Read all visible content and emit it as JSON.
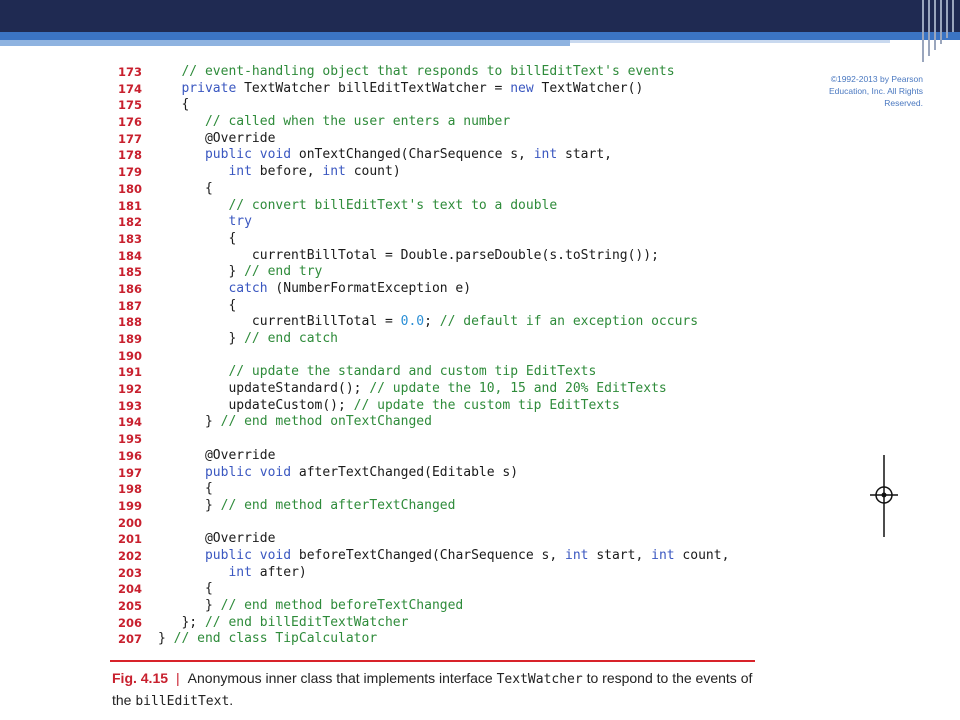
{
  "copyright": {
    "line1": "©1992-2013 by Pearson",
    "line2": "Education, Inc. All Rights",
    "line3": "Reserved."
  },
  "code": {
    "lines": [
      {
        "num": "173",
        "segments": [
          {
            "t": "   ",
            "k": "code"
          },
          {
            "t": "// event-handling object that responds to billEditText's events",
            "k": "comment"
          }
        ]
      },
      {
        "num": "174",
        "segments": [
          {
            "t": "   ",
            "k": "code"
          },
          {
            "t": "private",
            "k": "keyword"
          },
          {
            "t": " TextWatcher billEditTextWatcher = ",
            "k": "code"
          },
          {
            "t": "new",
            "k": "keyword"
          },
          {
            "t": " TextWatcher()",
            "k": "code"
          }
        ]
      },
      {
        "num": "175",
        "segments": [
          {
            "t": "   {",
            "k": "code"
          }
        ]
      },
      {
        "num": "176",
        "segments": [
          {
            "t": "      ",
            "k": "code"
          },
          {
            "t": "// called when the user enters a number",
            "k": "comment"
          }
        ]
      },
      {
        "num": "177",
        "segments": [
          {
            "t": "      @Override",
            "k": "code"
          }
        ]
      },
      {
        "num": "178",
        "segments": [
          {
            "t": "      ",
            "k": "code"
          },
          {
            "t": "public",
            "k": "keyword"
          },
          {
            "t": " ",
            "k": "code"
          },
          {
            "t": "void",
            "k": "keyword"
          },
          {
            "t": " onTextChanged(CharSequence s, ",
            "k": "code"
          },
          {
            "t": "int",
            "k": "keyword"
          },
          {
            "t": " start,",
            "k": "code"
          }
        ]
      },
      {
        "num": "179",
        "segments": [
          {
            "t": "         ",
            "k": "code"
          },
          {
            "t": "int",
            "k": "keyword"
          },
          {
            "t": " before, ",
            "k": "code"
          },
          {
            "t": "int",
            "k": "keyword"
          },
          {
            "t": " count)",
            "k": "code"
          }
        ]
      },
      {
        "num": "180",
        "segments": [
          {
            "t": "      {",
            "k": "code"
          }
        ]
      },
      {
        "num": "181",
        "segments": [
          {
            "t": "         ",
            "k": "code"
          },
          {
            "t": "// convert billEditText's text to a double",
            "k": "comment"
          }
        ]
      },
      {
        "num": "182",
        "segments": [
          {
            "t": "         ",
            "k": "code"
          },
          {
            "t": "try",
            "k": "keyword"
          }
        ]
      },
      {
        "num": "183",
        "segments": [
          {
            "t": "         {",
            "k": "code"
          }
        ]
      },
      {
        "num": "184",
        "segments": [
          {
            "t": "            currentBillTotal = Double.parseDouble(s.toString());",
            "k": "code"
          }
        ]
      },
      {
        "num": "185",
        "segments": [
          {
            "t": "         } ",
            "k": "code"
          },
          {
            "t": "// end try",
            "k": "comment"
          }
        ]
      },
      {
        "num": "186",
        "segments": [
          {
            "t": "         ",
            "k": "code"
          },
          {
            "t": "catch",
            "k": "keyword"
          },
          {
            "t": " (NumberFormatException e)",
            "k": "code"
          }
        ]
      },
      {
        "num": "187",
        "segments": [
          {
            "t": "         {",
            "k": "code"
          }
        ]
      },
      {
        "num": "188",
        "segments": [
          {
            "t": "            currentBillTotal = ",
            "k": "code"
          },
          {
            "t": "0.0",
            "k": "number"
          },
          {
            "t": "; ",
            "k": "code"
          },
          {
            "t": "// default if an exception occurs",
            "k": "comment"
          }
        ]
      },
      {
        "num": "189",
        "segments": [
          {
            "t": "         } ",
            "k": "code"
          },
          {
            "t": "// end catch",
            "k": "comment"
          }
        ]
      },
      {
        "num": "190",
        "segments": []
      },
      {
        "num": "191",
        "segments": [
          {
            "t": "         ",
            "k": "code"
          },
          {
            "t": "// update the standard and custom tip EditTexts",
            "k": "comment"
          }
        ]
      },
      {
        "num": "192",
        "segments": [
          {
            "t": "         updateStandard(); ",
            "k": "code"
          },
          {
            "t": "// update the 10, 15 and 20% EditTexts",
            "k": "comment"
          }
        ]
      },
      {
        "num": "193",
        "segments": [
          {
            "t": "         updateCustom(); ",
            "k": "code"
          },
          {
            "t": "// update the custom tip EditTexts",
            "k": "comment"
          }
        ]
      },
      {
        "num": "194",
        "segments": [
          {
            "t": "      } ",
            "k": "code"
          },
          {
            "t": "// end method onTextChanged",
            "k": "comment"
          }
        ]
      },
      {
        "num": "195",
        "segments": []
      },
      {
        "num": "196",
        "segments": [
          {
            "t": "      @Override",
            "k": "code"
          }
        ]
      },
      {
        "num": "197",
        "segments": [
          {
            "t": "      ",
            "k": "code"
          },
          {
            "t": "public",
            "k": "keyword"
          },
          {
            "t": " ",
            "k": "code"
          },
          {
            "t": "void",
            "k": "keyword"
          },
          {
            "t": " afterTextChanged(Editable s)",
            "k": "code"
          }
        ]
      },
      {
        "num": "198",
        "segments": [
          {
            "t": "      {",
            "k": "code"
          }
        ]
      },
      {
        "num": "199",
        "segments": [
          {
            "t": "      } ",
            "k": "code"
          },
          {
            "t": "// end method afterTextChanged",
            "k": "comment"
          }
        ]
      },
      {
        "num": "200",
        "segments": []
      },
      {
        "num": "201",
        "segments": [
          {
            "t": "      @Override",
            "k": "code"
          }
        ]
      },
      {
        "num": "202",
        "segments": [
          {
            "t": "      ",
            "k": "code"
          },
          {
            "t": "public",
            "k": "keyword"
          },
          {
            "t": " ",
            "k": "code"
          },
          {
            "t": "void",
            "k": "keyword"
          },
          {
            "t": " beforeTextChanged(CharSequence s, ",
            "k": "code"
          },
          {
            "t": "int",
            "k": "keyword"
          },
          {
            "t": " start, ",
            "k": "code"
          },
          {
            "t": "int",
            "k": "keyword"
          },
          {
            "t": " count,",
            "k": "code"
          }
        ]
      },
      {
        "num": "203",
        "segments": [
          {
            "t": "         ",
            "k": "code"
          },
          {
            "t": "int",
            "k": "keyword"
          },
          {
            "t": " after)",
            "k": "code"
          }
        ]
      },
      {
        "num": "204",
        "segments": [
          {
            "t": "      {",
            "k": "code"
          }
        ]
      },
      {
        "num": "205",
        "segments": [
          {
            "t": "      } ",
            "k": "code"
          },
          {
            "t": "// end method beforeTextChanged",
            "k": "comment"
          }
        ]
      },
      {
        "num": "206",
        "segments": [
          {
            "t": "   }; ",
            "k": "code"
          },
          {
            "t": "// end billEditTextWatcher",
            "k": "comment"
          }
        ]
      },
      {
        "num": "207",
        "segments": [
          {
            "t": "} ",
            "k": "code"
          },
          {
            "t": "// end class TipCalculator",
            "k": "comment"
          }
        ]
      }
    ]
  },
  "caption": {
    "label": "Fig. 4.15",
    "separator": "|",
    "text_part1": "Anonymous inner class that implements interface ",
    "code_part1": "TextWatcher",
    "text_part2": " to respond to the events of the ",
    "code_part2": "billEditText",
    "text_part3": "."
  },
  "colors": {
    "header_dark": "#1f2a52",
    "header_blue": "#3b74c4",
    "line_number_red": "#c8202e",
    "comment_green": "#2e8b3a",
    "keyword_blue": "#3a57c0",
    "number_blue": "#2b8fd6"
  }
}
